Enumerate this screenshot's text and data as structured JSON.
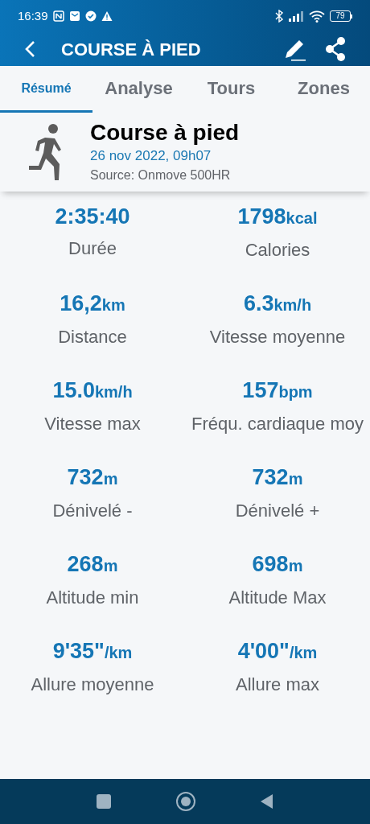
{
  "status_bar": {
    "time": "16:39",
    "battery": "79"
  },
  "app_bar": {
    "title": "COURSE À PIED"
  },
  "tabs": [
    {
      "label": "Résumé",
      "selected": true
    },
    {
      "label": "Analyse",
      "selected": false
    },
    {
      "label": "Tours",
      "selected": false
    },
    {
      "label": "Zones",
      "selected": false
    }
  ],
  "activity": {
    "title": "Course à pied",
    "date": "26 nov 2022, 09h07",
    "source": "Source: Onmove 500HR"
  },
  "stats": [
    {
      "value": "2:35:40",
      "label": "Durée"
    },
    {
      "value": "1798",
      "unit": "kcal",
      "label": "Calories"
    },
    {
      "value": "16,2",
      "unit": "km",
      "label": "Distance"
    },
    {
      "value": "6.3",
      "unit": "km/h",
      "label": "Vitesse moyenne"
    },
    {
      "value": "15.0",
      "unit": "km/h",
      "label": "Vitesse max"
    },
    {
      "value": "157",
      "unit": "bpm",
      "label": "Fréqu. cardiaque moy"
    },
    {
      "value": "732",
      "unit": "m",
      "label": "Dénivelé -"
    },
    {
      "value": "732",
      "unit": "m",
      "label": "Dénivelé +"
    },
    {
      "value": "268",
      "unit": "m",
      "label": "Altitude min"
    },
    {
      "value": "698",
      "unit": "m",
      "label": "Altitude Max"
    },
    {
      "value": "9'35\"",
      "unit": "/km",
      "label": "Allure moyenne"
    },
    {
      "value": "4'00\"",
      "unit": "/km",
      "label": "Allure max"
    }
  ]
}
